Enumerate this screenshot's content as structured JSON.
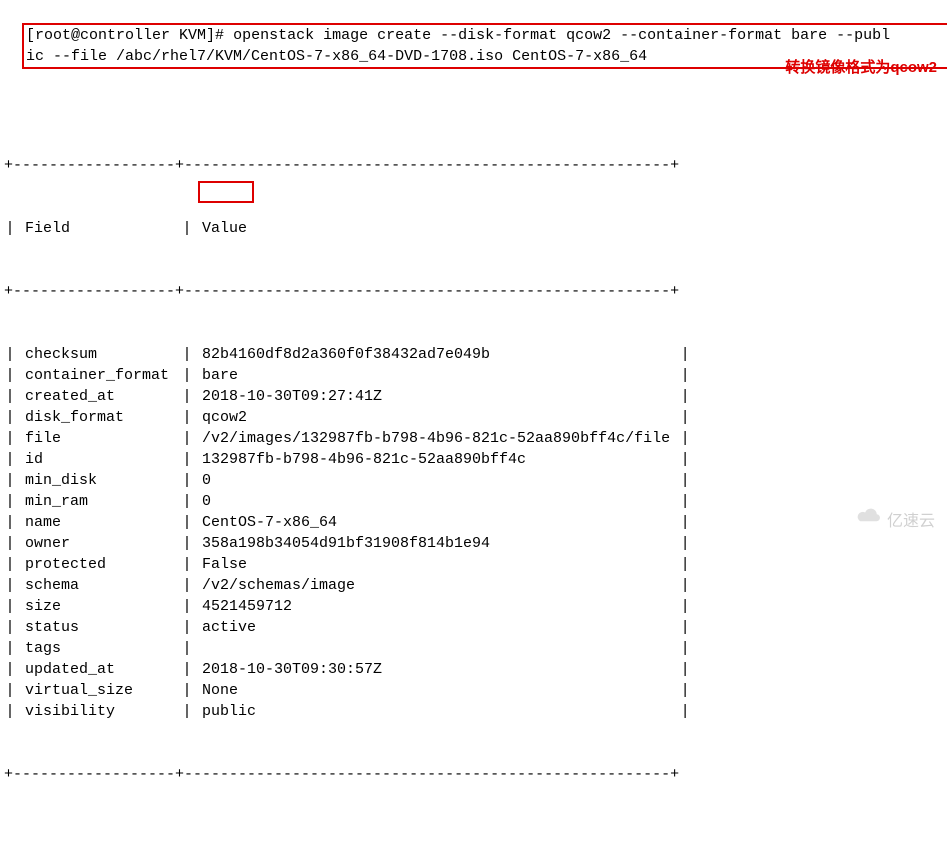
{
  "command": {
    "prompt": "[root@controller KVM]#",
    "line1": " openstack image create --disk-format qcow2 --container-format bare --publ",
    "line2": "ic --file /abc/rhel7/KVM/CentOS-7-x86_64-DVD-1708.iso CentOS-7-x86_64"
  },
  "annotation": "转换镜像格式为qcow2",
  "table": {
    "header": {
      "field": "Field",
      "value": "Value"
    },
    "rows": [
      {
        "field": "checksum",
        "value": "82b4160df8d2a360f0f38432ad7e049b"
      },
      {
        "field": "container_format",
        "value": "bare"
      },
      {
        "field": "created_at",
        "value": "2018-10-30T09:27:41Z"
      },
      {
        "field": "disk_format",
        "value": "qcow2"
      },
      {
        "field": "file",
        "value": "/v2/images/132987fb-b798-4b96-821c-52aa890bff4c/file"
      },
      {
        "field": "id",
        "value": "132987fb-b798-4b96-821c-52aa890bff4c"
      },
      {
        "field": "min_disk",
        "value": "0"
      },
      {
        "field": "min_ram",
        "value": "0"
      },
      {
        "field": "name",
        "value": "CentOS-7-x86_64"
      },
      {
        "field": "owner",
        "value": "358a198b34054d91bf31908f814b1e94"
      },
      {
        "field": "protected",
        "value": "False"
      },
      {
        "field": "schema",
        "value": "/v2/schemas/image"
      },
      {
        "field": "size",
        "value": "4521459712"
      },
      {
        "field": "status",
        "value": "active"
      },
      {
        "field": "tags",
        "value": ""
      },
      {
        "field": "updated_at",
        "value": "2018-10-30T09:30:57Z"
      },
      {
        "field": "virtual_size",
        "value": "None"
      },
      {
        "field": "visibility",
        "value": "public"
      }
    ],
    "sep": "+------------------+------------------------------------------------------+"
  },
  "watermark": "亿速云"
}
